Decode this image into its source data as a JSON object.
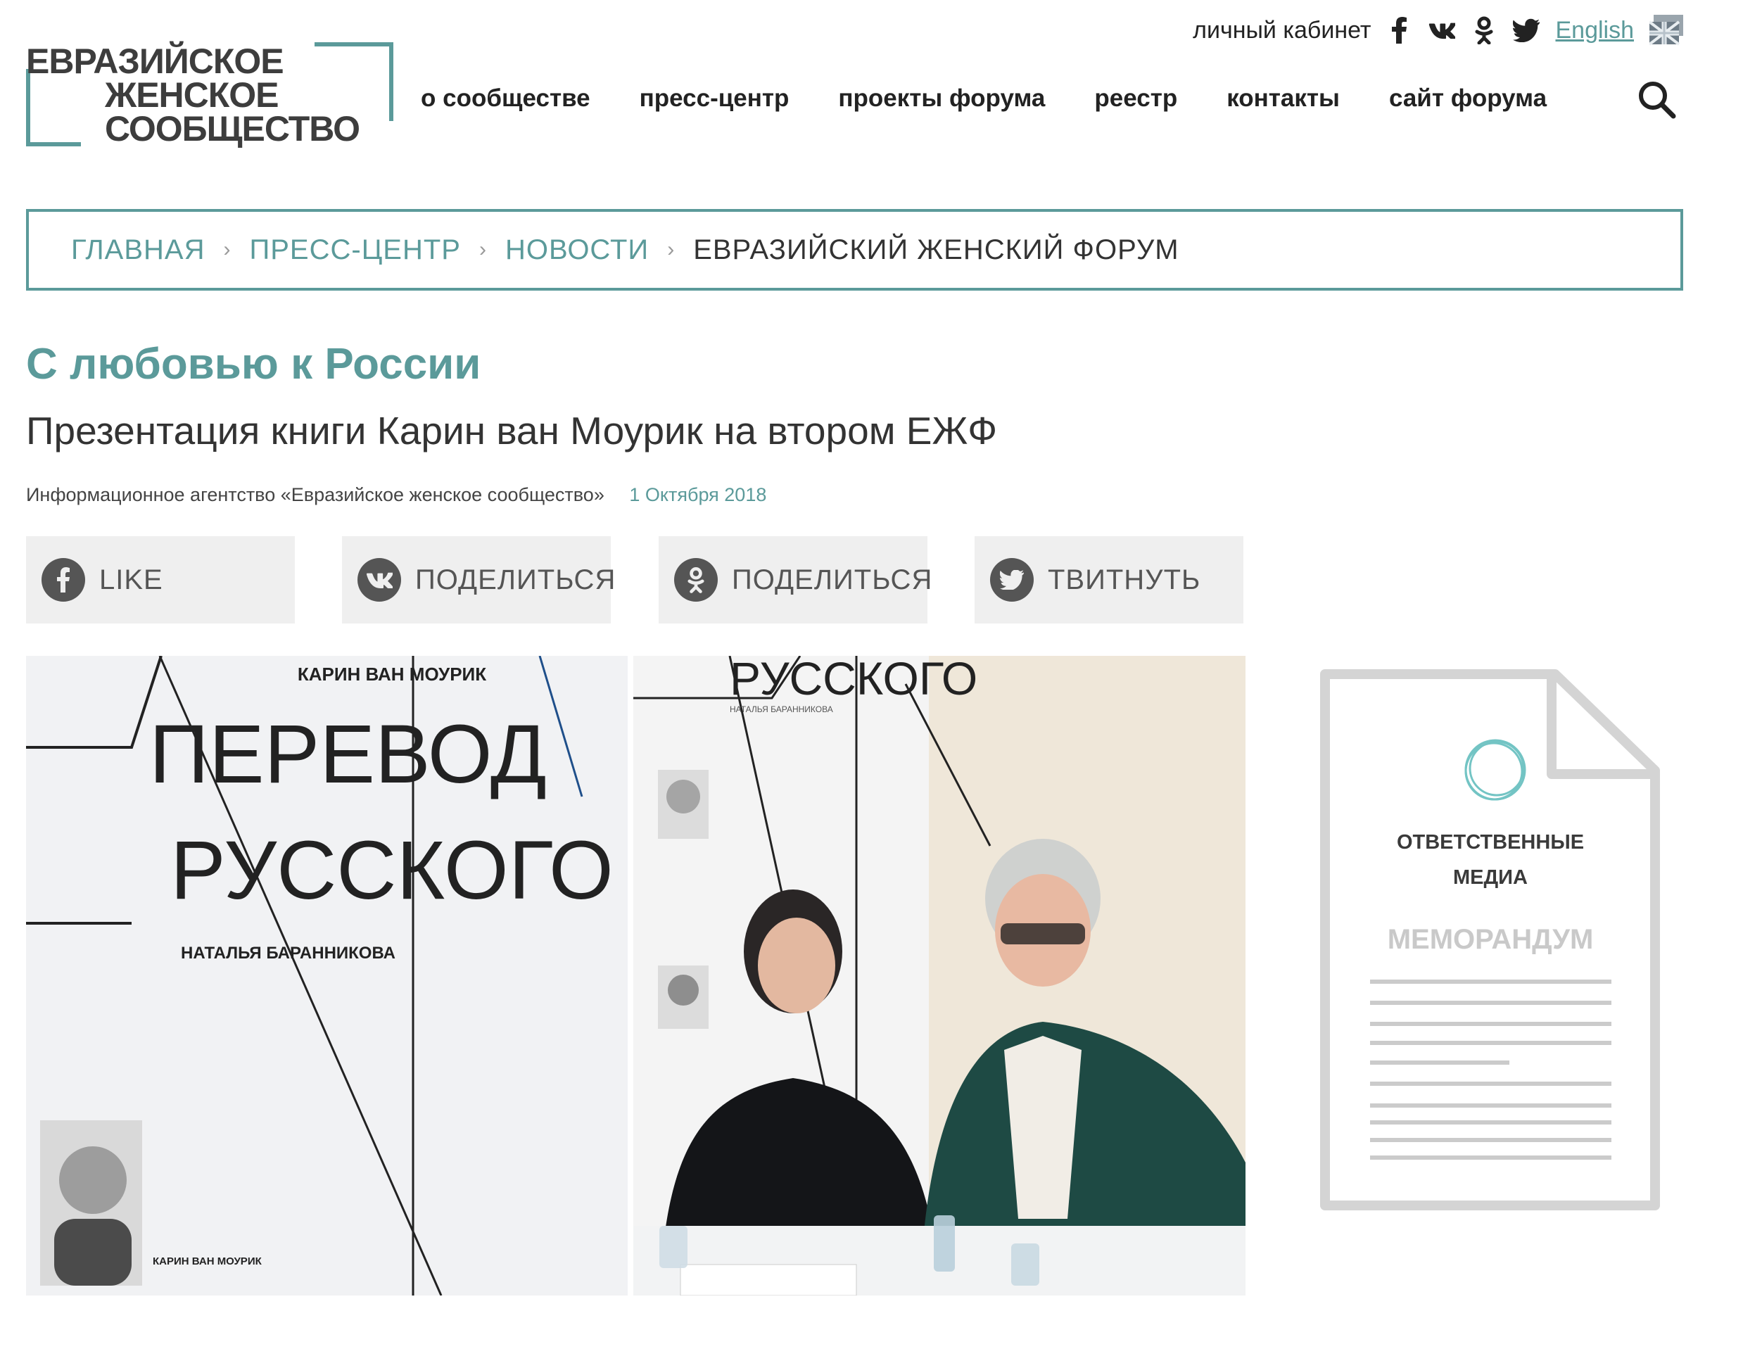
{
  "logo": {
    "line1": "ЕВРАЗИЙСКОЕ",
    "line2": "ЖЕНСКОЕ",
    "line3": "СООБЩЕСТВО"
  },
  "topbar": {
    "cabinet": "личный кабинет",
    "social_icons": [
      "facebook-icon",
      "vk-icon",
      "odnoklassniki-icon",
      "twitter-icon"
    ],
    "language": "English"
  },
  "nav": {
    "items": [
      "о сообществе",
      "пресс-центр",
      "проекты форума",
      "реестр",
      "контакты",
      "сайт форума"
    ]
  },
  "breadcrumb": {
    "items": [
      "Главная",
      "Пресс-центр",
      "Новости"
    ],
    "current": "Евразийский женский форум"
  },
  "article": {
    "title": "С любовью к России",
    "subtitle": "Презентация книги Карин ван Моурик на втором ЕЖФ",
    "source": "Информационное агентство «Евразийское женское сообщество»",
    "date": "1 Октября 2018"
  },
  "share": {
    "facebook": "LIKE",
    "vk": "ПОДЕЛИТЬСЯ",
    "ok": "ПОДЕЛИТЬСЯ",
    "twitter": "ТВИТНУТЬ"
  },
  "photo": {
    "banner_author": "КАРИН ВАН МОУРИК",
    "banner_word1": "ПЕРЕВОД",
    "banner_word2": "РУССКОГО",
    "banner_translator": "НАТАЛЬЯ БАРАННИКОВА",
    "banner_word2_right": "РУССКОГО",
    "banner_translator_right": "НАТАЛЬЯ БАРАННИКОВА",
    "portrait_caption": "КАРИН ВАН МОУРИК"
  },
  "memo": {
    "line1": "ОТВЕТСТВЕННЫЕ",
    "line2": "МЕДИА",
    "line3": "МЕМОРАНДУМ"
  },
  "colors": {
    "accent": "#5b9a9a",
    "text": "#222222",
    "button_bg": "#efefef"
  }
}
